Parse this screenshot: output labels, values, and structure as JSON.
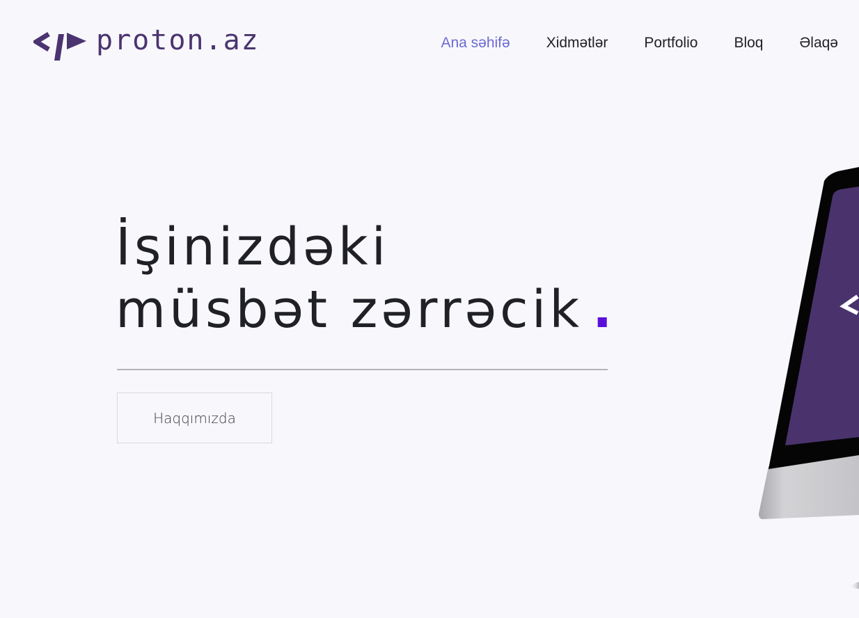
{
  "header": {
    "logo_text": "proton.az",
    "nav": [
      {
        "label": "Ana səhifə",
        "active": true
      },
      {
        "label": "Xidmətlər",
        "active": false
      },
      {
        "label": "Portfolio",
        "active": false
      },
      {
        "label": "Bloq",
        "active": false
      },
      {
        "label": "Əlaqə",
        "active": false
      }
    ]
  },
  "hero": {
    "title_line1": "İşinizdəki",
    "title_line2": "müsbət zərrəcik",
    "title_dot": ".",
    "button_label": "Haqqımızda"
  },
  "colors": {
    "brand": "#4b3470",
    "accent_nav": "#6c6ad4",
    "dot": "#5a10d9",
    "background": "#f8f8fc",
    "screen": "#4a336d"
  },
  "icons": {
    "logo": "code-brackets-icon",
    "illustration": "imac-monitor-illustration"
  }
}
